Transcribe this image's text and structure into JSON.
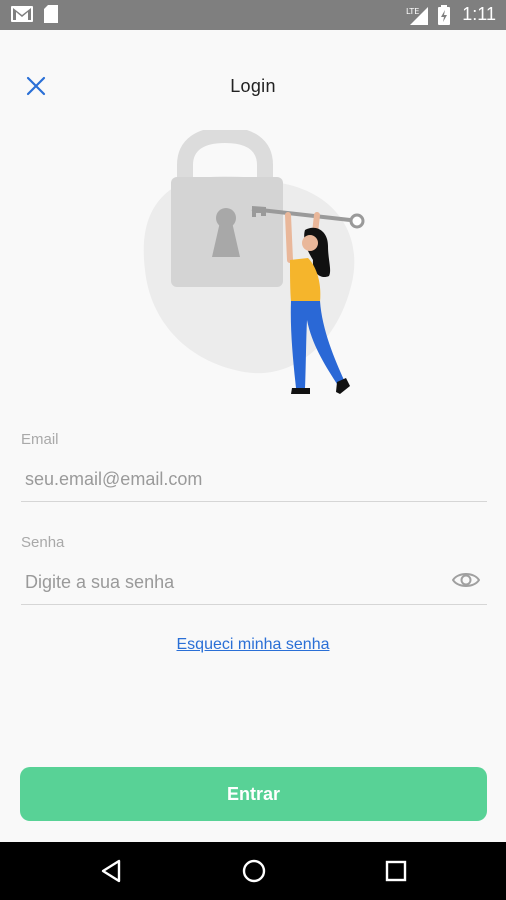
{
  "status_bar": {
    "time": "1:11",
    "network": "LTE",
    "icons": [
      "gmail-icon",
      "sim-card-icon",
      "signal-icon",
      "battery-icon"
    ]
  },
  "header": {
    "title": "Login",
    "close_icon": "close-icon"
  },
  "form": {
    "email": {
      "label": "Email",
      "placeholder": "seu.email@email.com"
    },
    "password": {
      "label": "Senha",
      "placeholder": "Digite a sua senha",
      "toggle_icon": "eye-icon"
    },
    "forgot_link": "Esqueci minha senha",
    "submit_label": "Entrar"
  },
  "colors": {
    "accent_button": "#58d296",
    "link": "#2a6fd6",
    "close_icon": "#2a6fd6"
  },
  "nav_bar": {
    "buttons": [
      "back-triangle-icon",
      "home-circle-icon",
      "recents-square-icon"
    ]
  }
}
